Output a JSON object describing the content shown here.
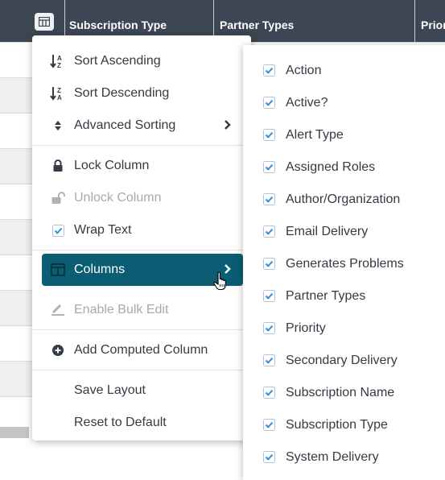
{
  "header": {
    "columns": [
      "Subscription Type",
      "Partner Types",
      "Prior"
    ],
    "menu_button_icon": "grid-menu-icon"
  },
  "menu": {
    "items": [
      {
        "label": "Sort Ascending",
        "icon": "sort-ascending-icon"
      },
      {
        "label": "Sort Descending",
        "icon": "sort-descending-icon"
      },
      {
        "label": "Advanced Sorting",
        "icon": "sort-updown-icon",
        "has_submenu": true
      },
      {
        "label": "Lock Column",
        "icon": "lock-icon"
      },
      {
        "label": "Unlock Column",
        "icon": "unlock-icon",
        "disabled": true
      },
      {
        "label": "Wrap Text",
        "icon": "checkbox-checked-icon",
        "checked": true
      },
      {
        "label": "Columns",
        "icon": "columns-icon",
        "has_submenu": true,
        "active": true
      },
      {
        "label": "Enable Bulk Edit",
        "icon": "bulk-edit-icon",
        "disabled": true
      },
      {
        "label": "Add Computed Column",
        "icon": "add-circle-icon"
      },
      {
        "label": "Save Layout"
      },
      {
        "label": "Reset to Default"
      }
    ]
  },
  "columns_submenu": {
    "items": [
      {
        "label": "Action",
        "checked": true
      },
      {
        "label": "Active?",
        "checked": true
      },
      {
        "label": "Alert Type",
        "checked": true
      },
      {
        "label": "Assigned Roles",
        "checked": true
      },
      {
        "label": "Author/Organization",
        "checked": true
      },
      {
        "label": "Email Delivery",
        "checked": true
      },
      {
        "label": "Generates Problems",
        "checked": true
      },
      {
        "label": "Partner Types",
        "checked": true
      },
      {
        "label": "Priority",
        "checked": true
      },
      {
        "label": "Secondary Delivery",
        "checked": true
      },
      {
        "label": "Subscription Name",
        "checked": true
      },
      {
        "label": "Subscription Type",
        "checked": true
      },
      {
        "label": "System Delivery",
        "checked": true
      }
    ]
  },
  "colors": {
    "header_bg": "#3d4754",
    "active_item_bg": "#0b5d74",
    "checkbox": "#2f8fd6"
  }
}
